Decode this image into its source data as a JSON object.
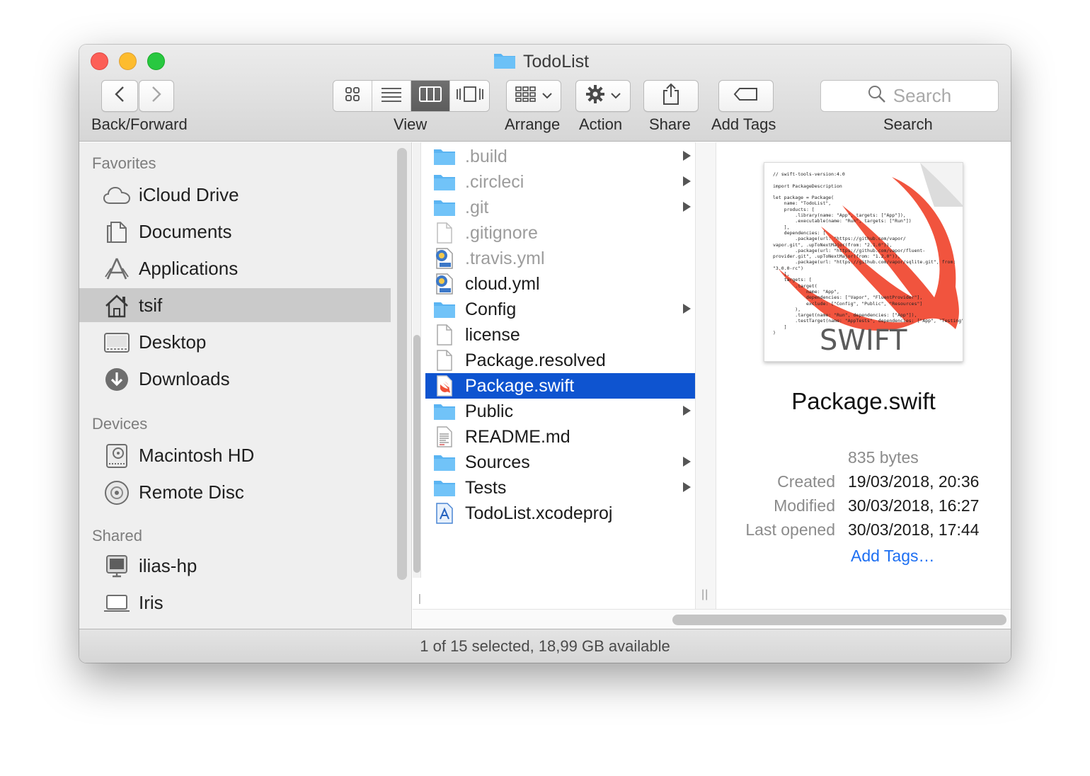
{
  "window": {
    "title": "TodoList",
    "folder_icon": "folder-icon"
  },
  "toolbar": {
    "back_forward_label": "Back/Forward",
    "view_label": "View",
    "arrange_label": "Arrange",
    "action_label": "Action",
    "share_label": "Share",
    "add_tags_label": "Add Tags",
    "search_label": "Search",
    "search_placeholder": "Search",
    "view_modes": [
      "icon-view",
      "list-view",
      "column-view",
      "cover-flow-view"
    ],
    "active_view": "column-view"
  },
  "sidebar": {
    "sections": [
      {
        "title": "Favorites",
        "items": [
          {
            "label": "iCloud Drive",
            "icon": "cloud-icon"
          },
          {
            "label": "Documents",
            "icon": "documents-icon"
          },
          {
            "label": "Applications",
            "icon": "applications-icon"
          },
          {
            "label": "tsif",
            "icon": "home-icon",
            "selected": true
          },
          {
            "label": "Desktop",
            "icon": "desktop-icon"
          },
          {
            "label": "Downloads",
            "icon": "downloads-icon"
          }
        ]
      },
      {
        "title": "Devices",
        "items": [
          {
            "label": "Macintosh HD",
            "icon": "hard-drive-icon"
          },
          {
            "label": "Remote Disc",
            "icon": "disc-icon"
          }
        ]
      },
      {
        "title": "Shared",
        "items": [
          {
            "label": "ilias-hp",
            "icon": "monitor-icon"
          },
          {
            "label": "Iris",
            "icon": "laptop-icon"
          }
        ]
      }
    ]
  },
  "files": [
    {
      "name": ".build",
      "type": "folder",
      "hidden": true,
      "has_children": true
    },
    {
      "name": ".circleci",
      "type": "folder",
      "hidden": true,
      "has_children": true
    },
    {
      "name": ".git",
      "type": "folder",
      "hidden": true,
      "has_children": true
    },
    {
      "name": ".gitignore",
      "type": "file",
      "hidden": true
    },
    {
      "name": ".travis.yml",
      "type": "yml",
      "hidden": true
    },
    {
      "name": "cloud.yml",
      "type": "yml"
    },
    {
      "name": "Config",
      "type": "folder",
      "has_children": true
    },
    {
      "name": "license",
      "type": "file"
    },
    {
      "name": "Package.resolved",
      "type": "file"
    },
    {
      "name": "Package.swift",
      "type": "swift",
      "selected": true
    },
    {
      "name": "Public",
      "type": "folder",
      "has_children": true
    },
    {
      "name": "README.md",
      "type": "text"
    },
    {
      "name": "Sources",
      "type": "folder",
      "has_children": true
    },
    {
      "name": "Tests",
      "type": "folder",
      "has_children": true
    },
    {
      "name": "TodoList.xcodeproj",
      "type": "xcodeproj"
    }
  ],
  "preview": {
    "name": "Package.swift",
    "size": "835 bytes",
    "created_label": "Created",
    "created": "19/03/2018, 20:36",
    "modified_label": "Modified",
    "modified": "30/03/2018, 16:27",
    "last_opened_label": "Last opened",
    "last_opened": "30/03/2018, 17:44",
    "add_tags": "Add Tags…",
    "thumbnail_brand": "SWIFT",
    "thumbnail_code": "// swift-tools-version:4.0\n\nimport PackageDescription\n\nlet package = Package(\n    name: \"TodoList\",\n    products: [\n        .library(name: \"App\", targets: [\"App\"]),\n        .executable(name: \"Run\", targets: [\"Run\"])\n    ],\n    dependencies: [\n        .package(url: \"https://github.com/vapor/\nvapor.git\", .upToNextMajor(from: \"2.1.0\")),\n        .package(url: \"https://github.com/vapor/fluent-\nprovider.git\", .upToNextMajor(from: \"1.2.0\")),\n        .package(url: \"https://github.com/vapor/sqlite.git\", from:\n\"3.0.0-rc\")\n    ],\n    targets: [\n        .target(\n            name: \"App\",\n            dependencies: [\"Vapor\", \"FluentProvider\"],\n            exclude: [\"Config\", \"Public\", \"Resources\"]\n        ),\n        .target(name: \"Run\", dependencies: [\"App\"]),\n        .testTarget(name: \"AppTests\", dependencies: [\"App\", \"Testing\"])\n    ]\n)"
  },
  "status": {
    "text": "1 of 15 selected, 18,99 GB available"
  },
  "colors": {
    "selection": "#0e54d0",
    "folder": "#5ab4f2",
    "link": "#1d6ff2",
    "swift": "#f05138"
  }
}
